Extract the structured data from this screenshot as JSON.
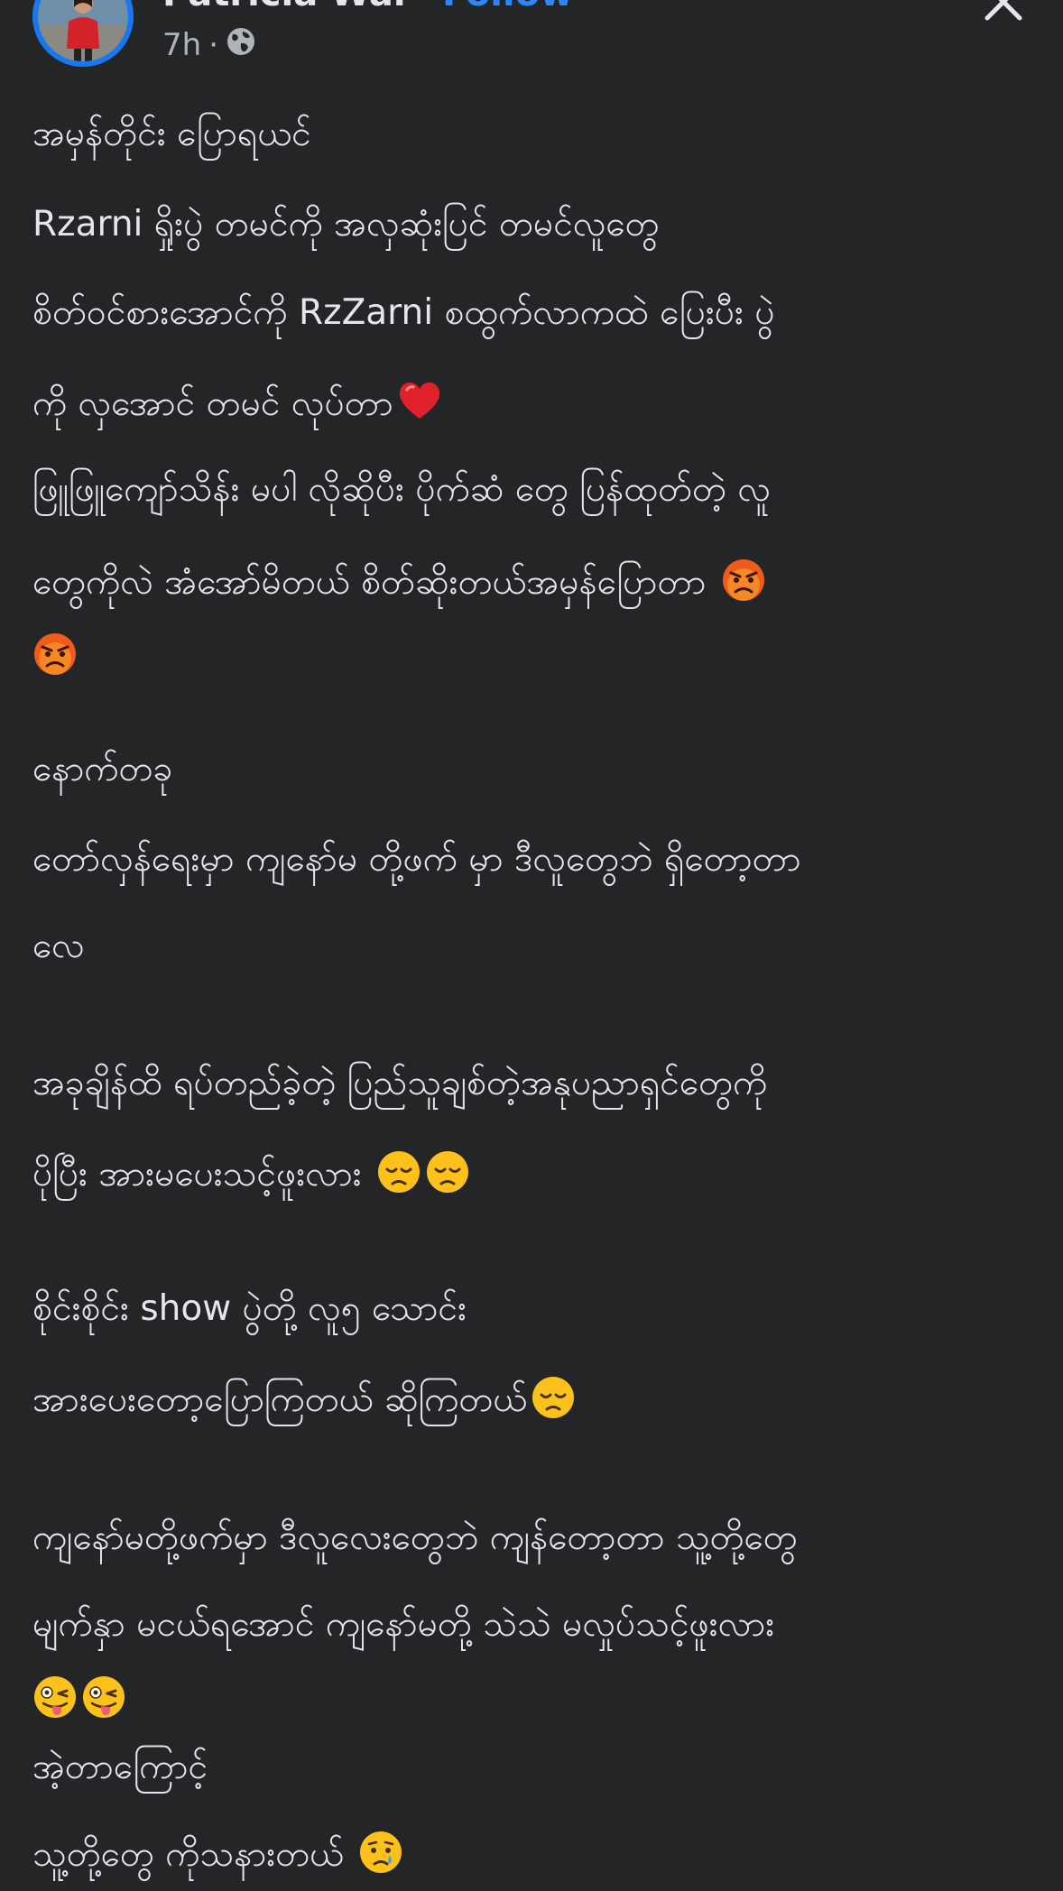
{
  "header": {
    "author": "Patricia Wai",
    "separator": "·",
    "follow_label": "Follow",
    "time": "7h",
    "meta_dot": "·",
    "privacy_icon": "globe-icon",
    "close_icon": "close-icon"
  },
  "post": {
    "lines": [
      "အမှန်တိုင်း ပြောရယင်",
      "Rzarni ရှိုးပွဲ တမင်ကို အလှဆုံးပြင် တမင်လူတွေ",
      "စိတ်ဝင်စားအောင်ကို   RzZarni စထွက်လာကထဲ ပြေးပီး ပွဲ",
      "ကို လှအောင် တမင် လုပ်တာ",
      "ဖြူဖြူကျော်သိန်း မပါ လိုဆိုပီး ပိုက်ဆံ တွေ ပြန်ထုတ်တဲ့ လူ",
      "တွေကိုလဲ အံအော်မိတယ် စိတ်ဆိုးတယ်အမှန်ပြောတာ ",
      "",
      "နောက်တခု",
      "တော်လှန်ရေးမှာ ကျနော်မ တို့ဖက် မှာ ဒီလူတွေဘဲ ရှိတော့တာ",
      "လေ",
      "အခုချိန်ထိ ရပ်တည်ခဲ့တဲ့ ပြည်သူချစ်တဲ့အနုပညာရှင်တွေကို",
      "ပိုပြီး အားမပေးသင့်ဖူးလား ",
      "စိုင်းစိုင်း show ပွဲတို့ လူ၅ သောင်း",
      "အားပေးတော့ပြောကြတယ် ဆိုကြတယ်",
      "ကျနော်မတို့ဖက်မှာ ဒီလူလေးတွေဘဲ ကျန်တော့တာ သူ့တို့တွေ",
      "မျက်နှာ မငယ်ရအောင် ကျနော်မတို့ သဲသဲ မလှုပ်သင့်ဖူးလား",
      "",
      "အဲ့တာကြောင့်",
      "သူ့တို့တွေ ကိုသနားတယ် "
    ],
    "emojis": {
      "heart": "red-heart-icon",
      "angry": "angry-face-icon",
      "disappointed": "disappointed-face-icon",
      "tongue": "winking-tongue-face-icon",
      "crying": "crying-face-icon"
    }
  },
  "colors": {
    "background": "#242526",
    "text": "#e4e6eb",
    "secondary_text": "#b0b3b8",
    "link": "#2d88ff",
    "avatar_ring": "#1877f2"
  }
}
